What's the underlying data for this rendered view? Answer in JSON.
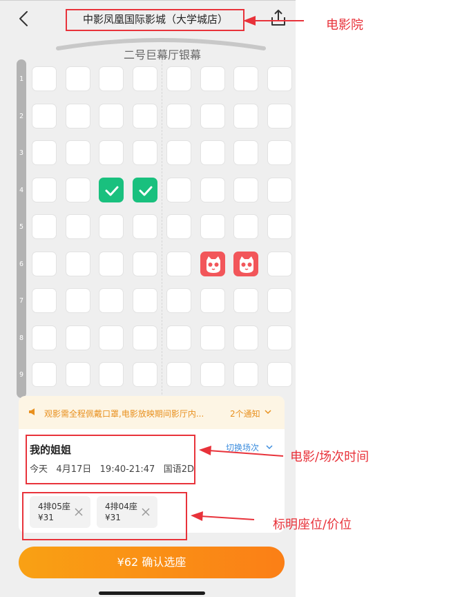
{
  "header": {
    "cinema_name": "中影凤凰国际影城（大学城店）",
    "hall_name": "二号巨幕厅银幕"
  },
  "seat_map": {
    "rows": [
      "1",
      "2",
      "3",
      "4",
      "5",
      "6",
      "7",
      "8",
      "9"
    ],
    "columns_per_row": 8,
    "selected_seats": [
      {
        "row": 4,
        "col": 3
      },
      {
        "row": 4,
        "col": 4
      }
    ],
    "sold_seats": [
      {
        "row": 6,
        "col": 6
      },
      {
        "row": 6,
        "col": 7
      }
    ]
  },
  "notice": {
    "text": "观影需全程佩戴口罩,电影放映期间影厅内...",
    "count_label": "2个通知"
  },
  "movie": {
    "title": "我的姐姐",
    "switch_label": "切换场次",
    "day": "今天",
    "date": "4月17日",
    "time": "19:40-21:47",
    "format": "国语2D"
  },
  "tickets": [
    {
      "seat": "4排05座",
      "price": "¥31"
    },
    {
      "seat": "4排04座",
      "price": "¥31"
    }
  ],
  "confirm": {
    "price": "¥62",
    "label": "确认选座"
  },
  "annotations": {
    "cinema": "电影院",
    "movie_time": "电影/场次时间",
    "seat_price": "标明座位/价位"
  },
  "colors": {
    "selected": "#19c07e",
    "sold": "#f2565a",
    "accent": "#fb8c16",
    "annotation": "#e8323a"
  }
}
